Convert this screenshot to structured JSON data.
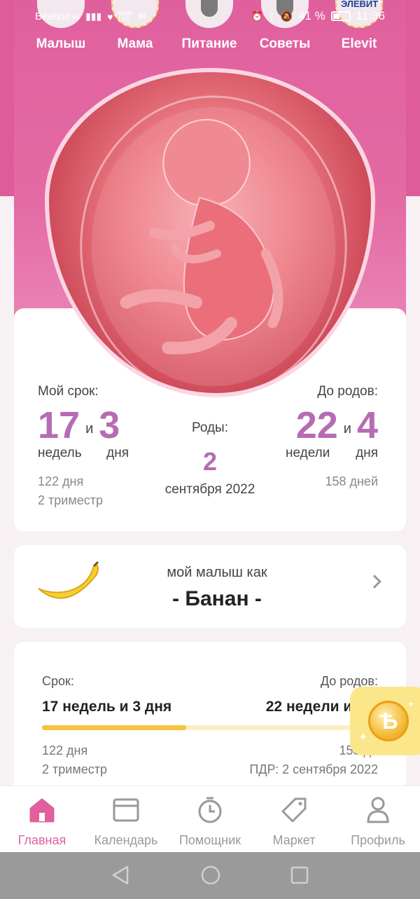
{
  "colors": {
    "brand_pink": "#e0609e",
    "accent_purple": "#b66cb3",
    "progress_yellow": "#f5c33d",
    "progress_track": "#fbefc4"
  },
  "status_bar": {
    "carrier": "Beeline",
    "network": "4G",
    "battery": "41 %",
    "time": "11:36",
    "icons": [
      "heart-icon",
      "mom-life-icon",
      "mail-icon",
      "alarm-icon",
      "bluetooth-icon",
      "mute-icon",
      "battery-icon"
    ]
  },
  "top_nav": {
    "items": [
      {
        "label": "Малыш"
      },
      {
        "label": "Мама"
      },
      {
        "label": "Питание"
      },
      {
        "label": "Советы"
      },
      {
        "label": "Elevit",
        "badge": "ЭЛЕВИТ"
      }
    ]
  },
  "term_card": {
    "my_term_label": "Мой срок:",
    "weeks_num": "17",
    "and_word": "и",
    "days_num": "3",
    "weeks_unit": "недель",
    "days_unit": "дня",
    "days_total": "122 дня",
    "trimester": "2 триместр",
    "birth_label": "Роды:",
    "birth_day": "2",
    "birth_month_year": "сентября 2022",
    "until_label": "До родов:",
    "until_weeks_num": "22",
    "until_and": "и",
    "until_days_num": "4",
    "until_weeks_unit": "недели",
    "until_days_unit": "дня",
    "until_days_total": "158 дней"
  },
  "size_card": {
    "caption": "мой малыш как",
    "fruit": "- Банан -",
    "icon": "banana-icon"
  },
  "progress_card": {
    "term_label": "Срок:",
    "term_value": "17 недель и 3 дня",
    "until_label": "До родов:",
    "until_value": "22 недели и 4 д",
    "progress_fraction": 0.43,
    "days_total": "122 дня",
    "trimester": "2 триместр",
    "until_days": "158 дн",
    "due_date": "ПДР: 2 сентября 2022"
  },
  "bonus": {
    "icon": "bonus-coin-icon",
    "glyph": "Ѣ"
  },
  "tab_bar": {
    "items": [
      {
        "label": "Главная",
        "icon": "home-icon",
        "active": true
      },
      {
        "label": "Календарь",
        "icon": "calendar-icon",
        "active": false
      },
      {
        "label": "Помощник",
        "icon": "stopwatch-icon",
        "active": false
      },
      {
        "label": "Маркет",
        "icon": "tag-icon",
        "active": false
      },
      {
        "label": "Профиль",
        "icon": "profile-icon",
        "active": false
      }
    ]
  }
}
